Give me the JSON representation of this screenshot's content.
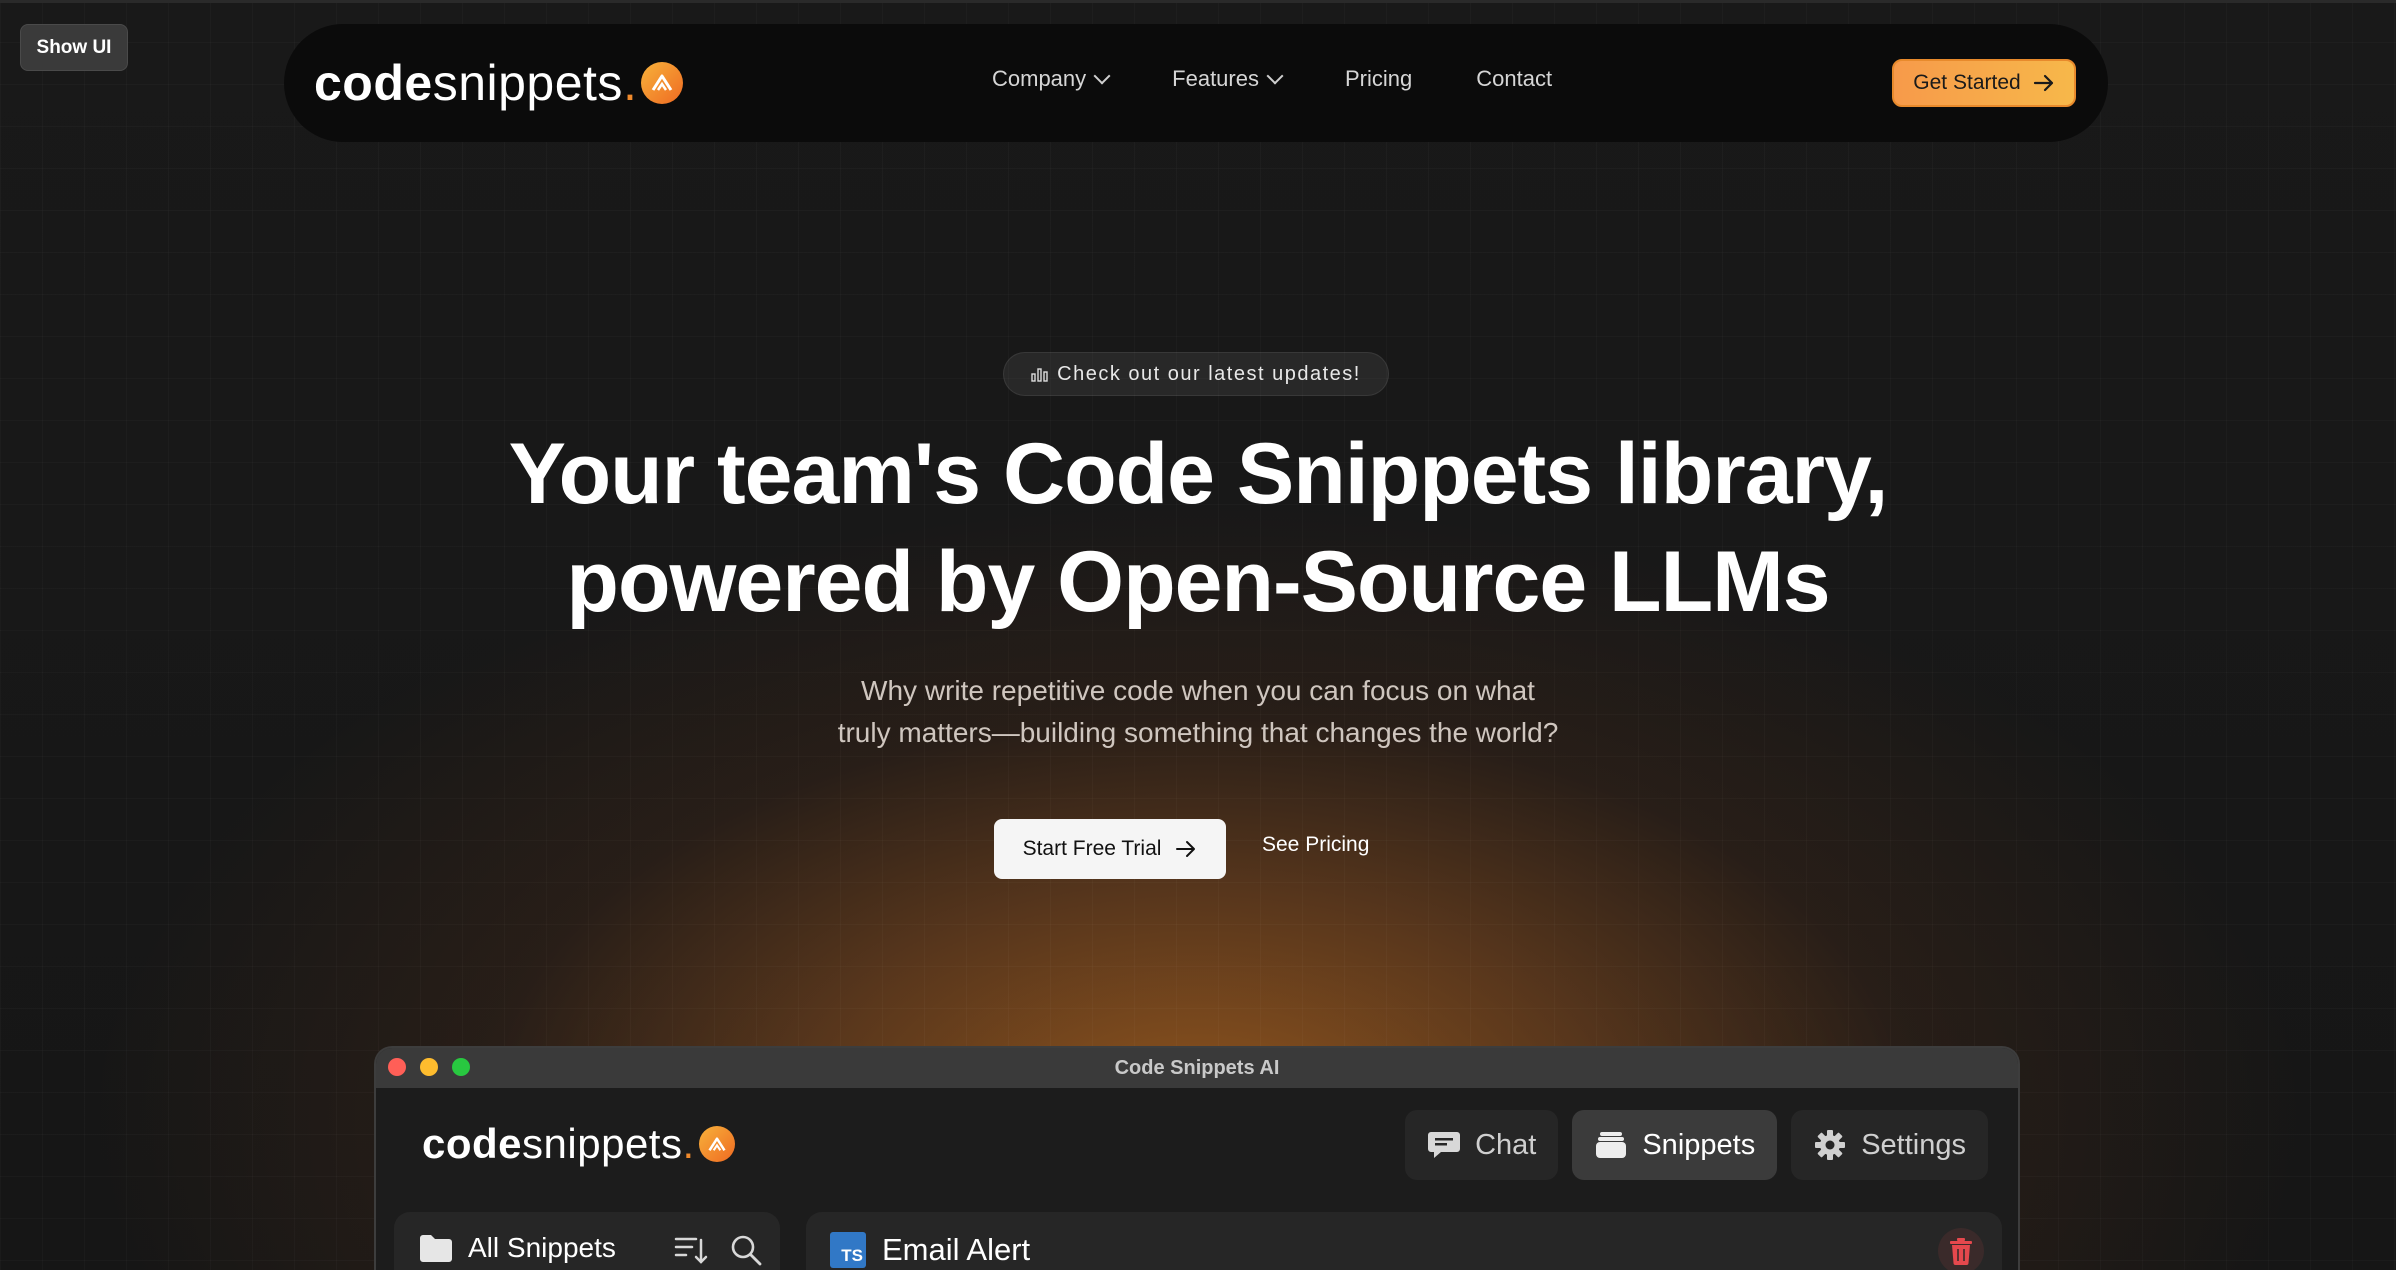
{
  "show_ui": "Show UI",
  "nav": {
    "logo": {
      "bold": "code",
      "light": "snippets",
      "dot": "."
    },
    "links": [
      {
        "label": "Company",
        "has_dropdown": true
      },
      {
        "label": "Features",
        "has_dropdown": true
      },
      {
        "label": "Pricing",
        "has_dropdown": false
      },
      {
        "label": "Contact",
        "has_dropdown": false
      }
    ],
    "cta": "Get Started"
  },
  "hero": {
    "badge": "Check out our latest updates!",
    "title_line1": "Your team's Code Snippets library,",
    "title_line2": "powered by Open-Source LLMs",
    "subtitle_line1": "Why write repetitive code when you can focus on what",
    "subtitle_line2": "truly matters—building something that changes the world?",
    "primary_button": "Start Free Trial",
    "secondary_button": "See Pricing"
  },
  "app_window": {
    "title": "Code Snippets AI",
    "logo": {
      "bold": "code",
      "light": "snippets",
      "dot": "."
    },
    "tabs": [
      {
        "label": "Chat",
        "icon": "chat-icon",
        "active": false
      },
      {
        "label": "Snippets",
        "icon": "stack-icon",
        "active": true
      },
      {
        "label": "Settings",
        "icon": "gear-icon",
        "active": false
      }
    ],
    "sidebar_title": "All Snippets",
    "snippet_title": "Email Alert",
    "snippet_lang_badge": "TS"
  },
  "colors": {
    "accent": "#f79a4a",
    "traffic_red": "#ff5f57",
    "traffic_yellow": "#febc2e",
    "traffic_green": "#28c840",
    "trash_red": "#e5484d"
  }
}
